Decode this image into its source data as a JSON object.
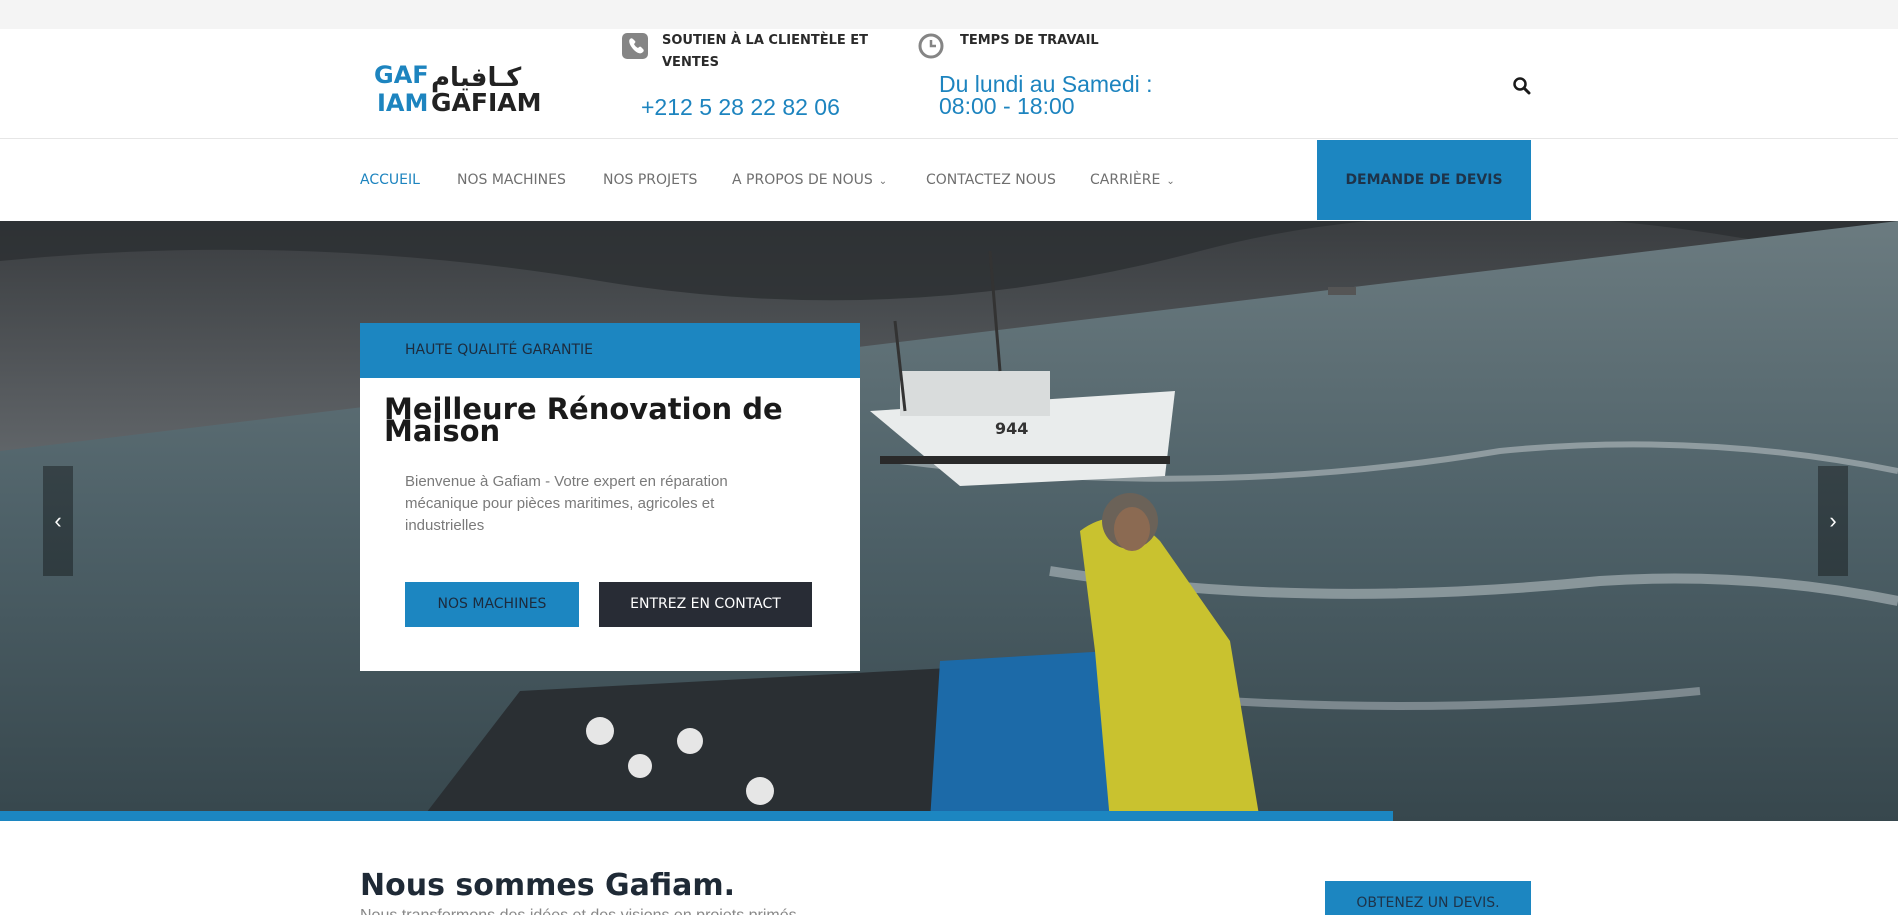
{
  "header": {
    "logo": {
      "latin": "GAFIAM",
      "arabic": "كـافيام",
      "mark": "GAF IAM"
    },
    "support": {
      "title": "SOUTIEN À LA CLIENTÈLE ET VENTES",
      "value": "+212 5 28 22 82 06",
      "icon": "phone-icon"
    },
    "hours": {
      "title": "TEMPS DE TRAVAIL",
      "value": "Du lundi au Samedi : 08:00 - 18:00",
      "icon": "clock-icon"
    },
    "search_icon": "search-icon"
  },
  "nav": {
    "items": [
      {
        "label": "ACCUEIL",
        "active": true
      },
      {
        "label": "NOS MACHINES"
      },
      {
        "label": "NOS PROJETS"
      },
      {
        "label": "A PROPOS DE NOUS",
        "dropdown": true
      },
      {
        "label": "CONTACTEZ NOUS"
      },
      {
        "label": "CARRIÈRE",
        "dropdown": true
      }
    ],
    "cta": "DEMANDE DE DEVIS"
  },
  "hero": {
    "tag": "HAUTE QUALITÉ GARANTIE",
    "title": "Meilleure Rénovation de Maison",
    "description": "Bienvenue à Gafiam - Votre expert en réparation mécanique pour pièces maritimes, agricoles et industrielles",
    "primary_button": "NOS MACHINES",
    "secondary_button": "ENTREZ EN CONTACT",
    "prev_arrow": "‹",
    "next_arrow": "›",
    "boat_number": "944",
    "slide_progress_fraction": 0.734
  },
  "about": {
    "title": "Nous sommes Gafiam.",
    "subtitle": "Nous transformons des idées et des visions en projets primés",
    "quote_button": "OBTENEZ UN DEVIS."
  },
  "colors": {
    "accent": "#1c86c1",
    "dark": "#282c35",
    "nav_text": "#6f6f6f"
  }
}
